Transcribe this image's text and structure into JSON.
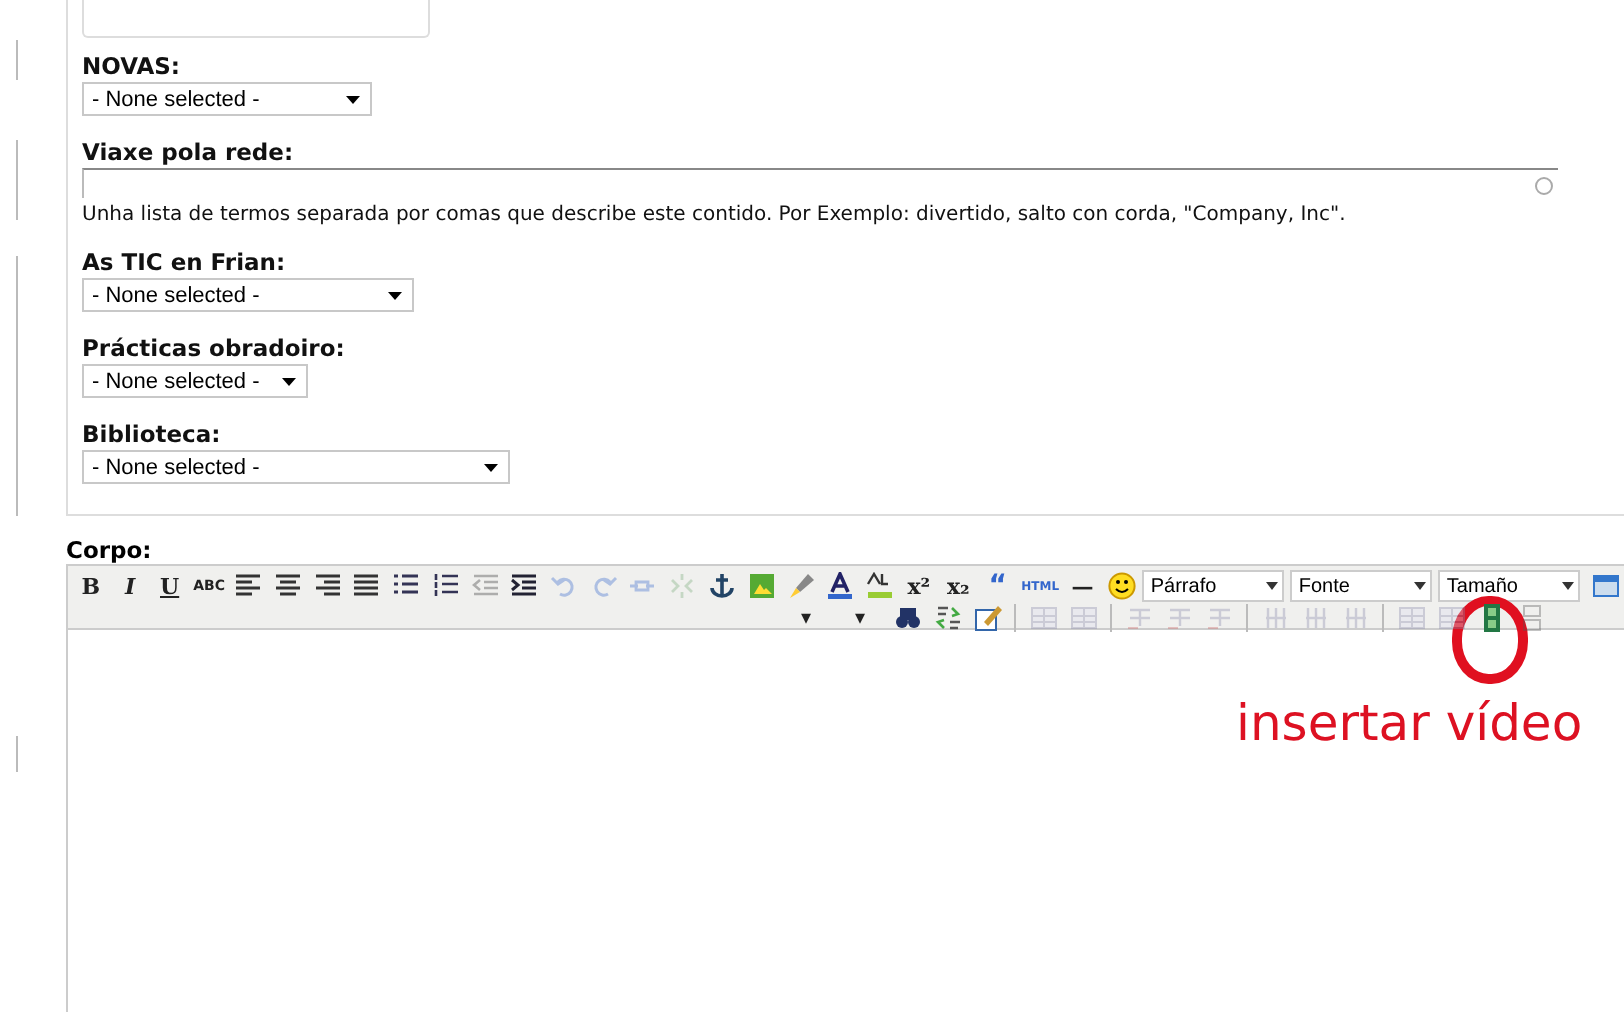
{
  "fields": [
    {
      "kind": "select",
      "label": "NOVAS:",
      "value": "- None selected -"
    },
    {
      "kind": "tags",
      "label": "Viaxe pola rede:",
      "description": "Unha lista de termos separada por comas que describe este contido. Por Exemplo: divertido, salto con corda, \"Company, Inc\"."
    },
    {
      "kind": "select",
      "label": "As TIC en Frian:",
      "value": "- None selected -"
    },
    {
      "kind": "select",
      "label": "Prácticas obradoiro:",
      "value": "- None selected -"
    },
    {
      "kind": "select",
      "label": "Biblioteca:",
      "value": "- None selected -"
    }
  ],
  "body": {
    "label": "Corpo:",
    "toolbar_row_1": [
      {
        "kind": "bold",
        "label": "B",
        "disabled": false
      },
      {
        "kind": "italic",
        "label": "I",
        "disabled": false
      },
      {
        "kind": "underline",
        "label": "U",
        "disabled": false
      },
      {
        "kind": "strike",
        "label": "ABC",
        "disabled": false
      },
      {
        "kind": "align-left",
        "disabled": false
      },
      {
        "kind": "align-center",
        "disabled": false
      },
      {
        "kind": "align-right",
        "disabled": false
      },
      {
        "kind": "align-justify",
        "disabled": false
      },
      {
        "kind": "bullets",
        "disabled": false
      },
      {
        "kind": "numbers",
        "disabled": false
      },
      {
        "kind": "outdent",
        "disabled": true
      },
      {
        "kind": "indent",
        "disabled": false
      },
      {
        "kind": "undo",
        "disabled": true
      },
      {
        "kind": "redo",
        "disabled": true
      },
      {
        "kind": "link",
        "disabled": true
      },
      {
        "kind": "unlink",
        "disabled": true
      },
      {
        "kind": "anchor",
        "disabled": false
      },
      {
        "kind": "image",
        "disabled": false
      },
      {
        "kind": "cleanup",
        "disabled": false
      },
      {
        "kind": "font-color",
        "disabled": false
      },
      {
        "kind": "highlight",
        "disabled": false
      },
      {
        "kind": "superscript",
        "label": "x²",
        "disabled": false
      },
      {
        "kind": "subscript",
        "label": "x₂",
        "disabled": false
      },
      {
        "kind": "quote",
        "label": "“",
        "disabled": false
      },
      {
        "kind": "html",
        "label": "HTML",
        "disabled": false
      },
      {
        "kind": "dash",
        "label": "—",
        "disabled": false
      },
      {
        "kind": "smiley",
        "disabled": false
      },
      {
        "kind": "select",
        "label": "Párrafo"
      },
      {
        "kind": "select",
        "label": "Fonte"
      },
      {
        "kind": "select",
        "label": "Tamaño"
      },
      {
        "kind": "window",
        "disabled": false
      }
    ],
    "toolbar_row_2": [
      {
        "kind": "arrow",
        "label": "▾",
        "disabled": false
      },
      {
        "kind": "arrow",
        "label": "▾",
        "disabled": false
      },
      {
        "kind": "find",
        "disabled": false
      },
      {
        "kind": "replace",
        "disabled": false
      },
      {
        "kind": "edit",
        "disabled": false
      },
      {
        "kind": "separator"
      },
      {
        "kind": "table",
        "disabled": true
      },
      {
        "kind": "table",
        "disabled": true
      },
      {
        "kind": "separator"
      },
      {
        "kind": "row",
        "disabled": true
      },
      {
        "kind": "row",
        "disabled": true
      },
      {
        "kind": "row",
        "disabled": true
      },
      {
        "kind": "separator"
      },
      {
        "kind": "column",
        "disabled": true
      },
      {
        "kind": "column",
        "disabled": true
      },
      {
        "kind": "column",
        "disabled": true
      },
      {
        "kind": "separator"
      },
      {
        "kind": "table",
        "disabled": true
      },
      {
        "kind": "table",
        "disabled": true
      },
      {
        "kind": "video",
        "disabled": false
      },
      {
        "kind": "page-break",
        "disabled": true
      }
    ]
  },
  "annotation": {
    "text": "insertar vídeo"
  }
}
